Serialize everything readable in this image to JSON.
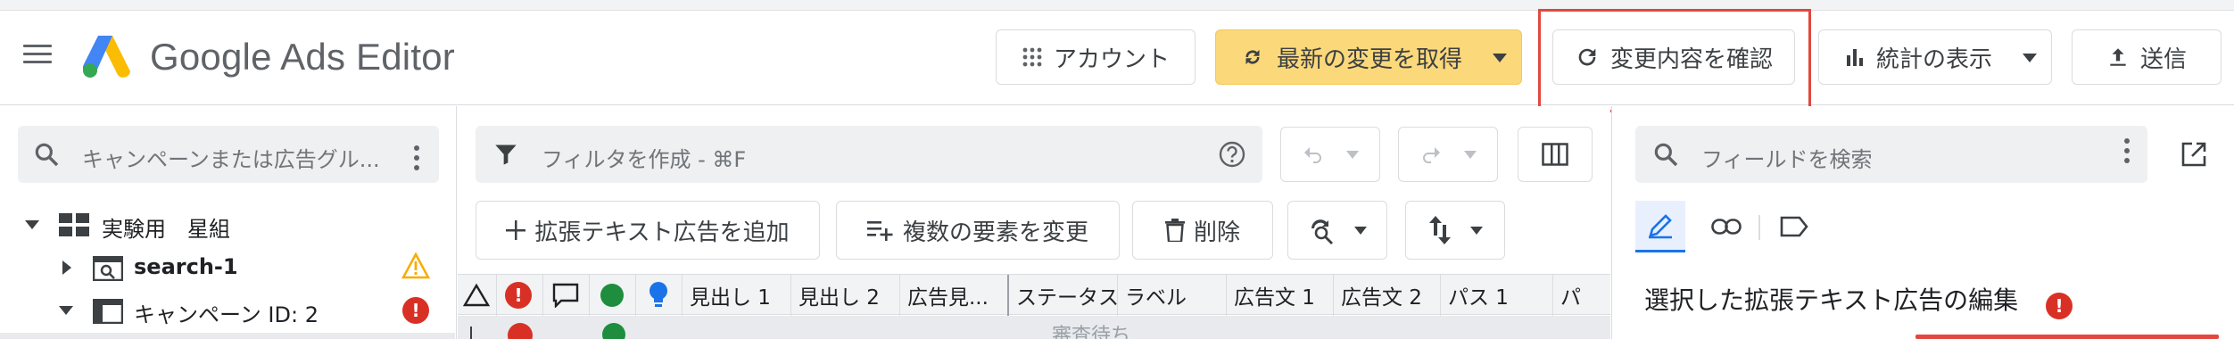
{
  "header": {
    "app_title": "Google Ads Editor",
    "buttons": {
      "account": "アカウント",
      "fetch_changes": "最新の変更を取得",
      "review_changes": "変更内容を確認",
      "view_stats": "統計の表示",
      "send": "送信"
    },
    "fetch_color": "#fbd87a",
    "highlight_color": "#e2483d"
  },
  "left_panel": {
    "search_placeholder": "キャンペーンまたは広告グル...",
    "tree": [
      {
        "label": "実験用　星組",
        "icon": "grid-icon",
        "expanded": true
      },
      {
        "label": "search-1",
        "icon": "search-campaign-icon",
        "status": "warning"
      },
      {
        "label": "キャンペーン ID: 2",
        "icon": "campaign-icon",
        "status": "error",
        "expanded": true
      }
    ]
  },
  "center": {
    "filter_placeholder": "フィルタを作成 - ⌘F",
    "actions": {
      "add_expanded_text_ad": "拡張テキスト広告を追加",
      "change_multiple": "複数の要素を変更",
      "delete": "削除"
    },
    "columns": [
      "見出し 1",
      "見出し 2",
      "広告見...",
      "ステータス",
      "ラベル",
      "広告文 1",
      "広告文 2",
      "パス 1",
      "パ"
    ],
    "partial_row_status": "審査待ち"
  },
  "right_panel": {
    "search_placeholder": "フィールドを検索",
    "edit_title": "選択した拡張テキスト広告の編集"
  }
}
